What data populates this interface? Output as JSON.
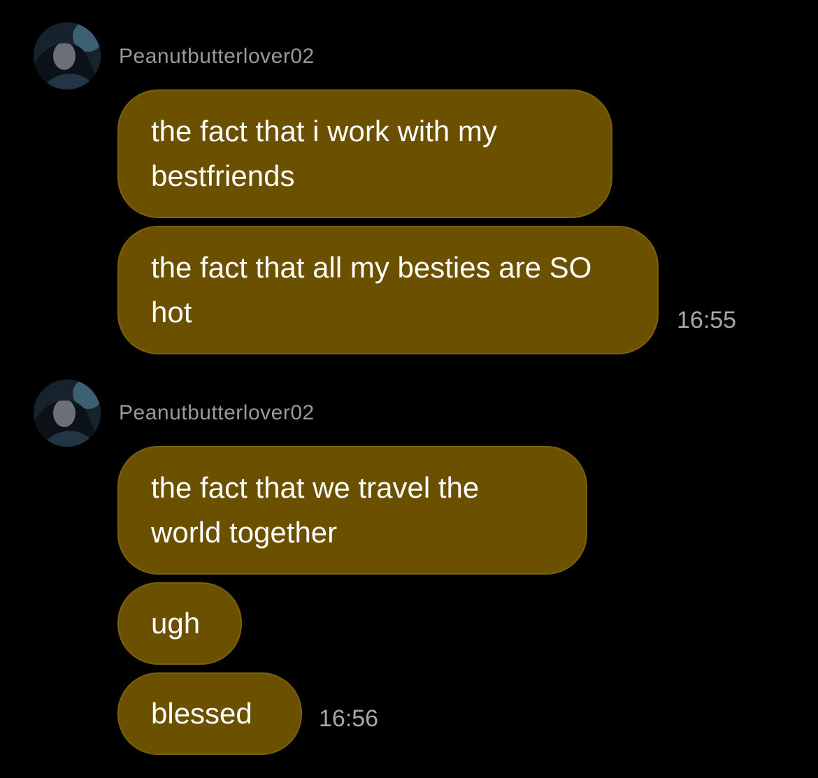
{
  "chat": {
    "groups": [
      {
        "sender": "Peanutbutterlover02",
        "avatar": "user-avatar",
        "messages": [
          "the fact that i work with my bestfriends",
          "the fact that all my besties are SO hot"
        ],
        "timestamp": "16:55"
      },
      {
        "sender": "Peanutbutterlover02",
        "avatar": "user-avatar",
        "messages": [
          "the fact that we travel the world together",
          "ugh",
          "blessed"
        ],
        "timestamp": "16:56"
      }
    ]
  },
  "colors": {
    "background": "#000000",
    "bubble": "#6b5000",
    "sender_text": "#9a9a9a",
    "timestamp_text": "#a7a7a7",
    "message_text": "#ffffff"
  }
}
